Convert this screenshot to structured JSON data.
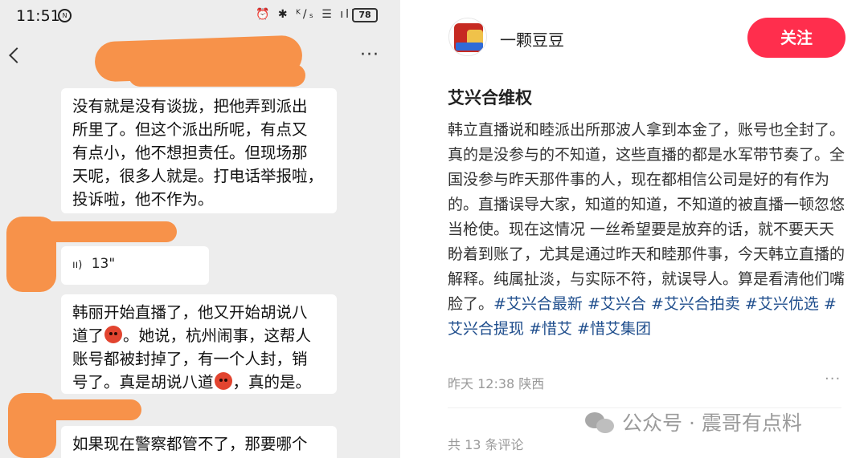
{
  "status_bar": {
    "time": "11:51",
    "time_badge": "N",
    "icons_text": "⏰ ✱ ᴷ/ₛ ☰ ıll",
    "battery": "78"
  },
  "chat": {
    "more": "···",
    "messages": [
      {
        "type": "text",
        "text": "没有就是没有谈拢，把他弄到派出\n所里了。但这个派出所呢，有点又\n有点小，他不想担责任。但现场那\n天呢，很多人就是。打电话举报啦，\n投诉啦，他不作为。"
      },
      {
        "type": "voice",
        "duration": "13\""
      },
      {
        "type": "text_emoji",
        "line1": "韩丽开始直播了，他又开始胡说八",
        "line2a": "道了",
        "line2b": "。她说，杭州闹事，这帮人",
        "line3": "账号都被封掉了，有一个人封，销",
        "line4a": "号了。真是胡说八道",
        "line4b": "，真的是。"
      },
      {
        "type": "text",
        "text": "如果现在警察都管不了，那要哪个"
      }
    ]
  },
  "post": {
    "username": "一颗豆豆",
    "follow_label": "关注",
    "title": "艾兴合维权",
    "body": "韩立直播说和睦派出所那波人拿到本金了，账号也全封了。真的是没参与的不知道，这些直播的都是水军带节奏了。全国没参与昨天那件事的人，现在都相信公司是好的有作为的。直播误导大家，知道的知道，不知道的被直播一顿忽悠当枪使。现在这情况 一丝希望要是放弃的话，就不要天天盼着到账了，尤其是通过昨天和睦那件事，今天韩立直播的解释。纯属扯淡，与实际不符，就误导人。算是看清他们嘴脸了。",
    "tags": [
      "#艾兴合最新",
      "#艾兴合",
      "#艾兴合拍卖",
      "#艾兴优选",
      "#艾兴合提现",
      "#惜艾",
      "#惜艾集团"
    ],
    "meta": "昨天 12:38 陕西",
    "more": "···",
    "comment_count": "共 13 条评论"
  },
  "watermark": "公众号 · 震哥有点料",
  "colors": {
    "follow_button": "#ff2e4d",
    "tag": "#1e4d8c",
    "redaction": "#f7924a",
    "chat_background": "#ededed"
  }
}
